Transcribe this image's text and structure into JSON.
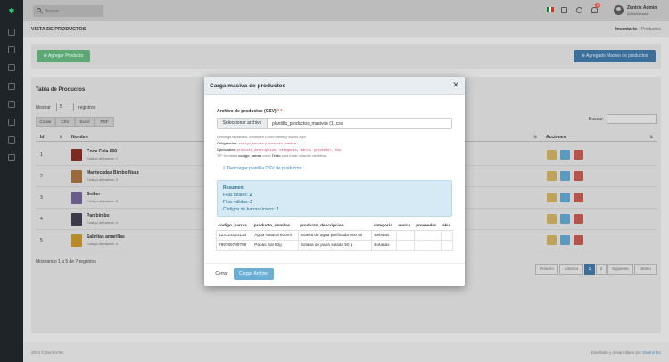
{
  "topbar": {
    "search_placeholder": "Buscar...",
    "user_name": "Zentrix Admin",
    "user_role": "Administrador",
    "notif_count": "1"
  },
  "header": {
    "title": "VISTA DE PRODUCTOS",
    "crumb_1": "Inventario",
    "crumb_sep": "›",
    "crumb_2": "Productos"
  },
  "actions": {
    "add_label": "Agregar Producto",
    "bulk_label": "Agregado Masivo de productos"
  },
  "table": {
    "title": "Tabla de Productos",
    "show_label": "Mostrar",
    "show_value": "5",
    "records_label": "registros",
    "export": [
      "Copiar",
      "CSV",
      "Excel",
      "PDF"
    ],
    "search_label": "Buscar:",
    "col_id": "Id",
    "col_name": "Nombre",
    "col_actions": "Acciones",
    "rows": [
      {
        "id": "1",
        "name": "Coca Cola 600",
        "code": "Código de barras: 1"
      },
      {
        "id": "2",
        "name": "Mantecadas Bimbo Nuez",
        "code": "Código de barras: 2"
      },
      {
        "id": "3",
        "name": "Sniker",
        "code": "Código de barras: 3"
      },
      {
        "id": "4",
        "name": "Pan bimbo",
        "code": "Código de barras: 4"
      },
      {
        "id": "5",
        "name": "Sabritas amarillas",
        "code": "Código de barras: 5"
      }
    ],
    "info": "Mostrando 1 a 5 de 7 registros",
    "pagination": [
      "Primero",
      "Anterior",
      "1",
      "2",
      "Siguiente",
      "Último"
    ]
  },
  "footer": {
    "left": "2024 © ZentrixTec",
    "right_prefix": "Diseñado y desarrollado por",
    "right_brand": "ZentrixTec"
  },
  "modal": {
    "title": "Carga masiva de productos",
    "close": "✕",
    "file_label": "Archivo de productos (CSV)",
    "required": "* *",
    "file_button": "Seleccionar archivo",
    "file_name": "plantilla_productos_masivos (1).csv",
    "help_1": "Descarga la plantilla, edítala en Excel/Sheets y súbela aquí.",
    "help_2_label": "Obligatorios:",
    "help_2_code": "codigo_barras",
    "help_2_mid": "y",
    "help_2_code2": "producto_nombre",
    "help_3_label": "Opcionales:",
    "help_3_code": "producto_descripcion, categoria, marca, proveedor, sku",
    "help_4_pre": "TIP: formatea",
    "help_4_b": "codigo_barras",
    "help_4_mid": "como",
    "help_4_b2": "Texto",
    "help_4_post": "para evitar notación científica.",
    "download": "Descargar plantilla CSV de productos",
    "summary_title": "Resumen:",
    "summary_total_label": "Filas totales:",
    "summary_total": "2",
    "summary_valid_label": "Filas válidas:",
    "summary_valid": "2",
    "summary_codes_label": "Códigos de barras únicos:",
    "summary_codes": "2",
    "preview_headers": [
      "codigo_barras",
      "producto_nombre",
      "producto_descripcion",
      "categoria",
      "marca",
      "proveedor",
      "sku"
    ],
    "preview_rows": [
      [
        "123123123123",
        "Agua Natural 600ml",
        "Botella de agua purificada 600 ml",
        "Bebidas",
        "",
        "",
        ""
      ],
      [
        "789789789789",
        "Papas Sal 50g",
        "Botana de papa salada 50 g",
        "Botanas",
        "",
        "",
        ""
      ]
    ],
    "cancel_label": "Cerrar",
    "submit_label": "Cargar Archivo"
  },
  "colors": {
    "primary": "#3b6f99",
    "success": "#5fa876",
    "danger": "#d9534f",
    "info": "#6aaed6"
  }
}
